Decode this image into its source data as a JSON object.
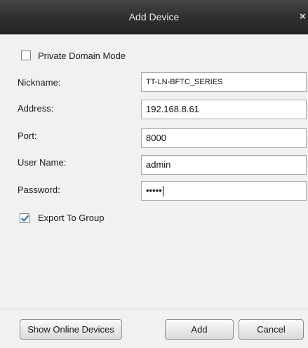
{
  "window": {
    "title": "Add Device",
    "close_glyph": "×"
  },
  "form": {
    "private_domain_label": "Private Domain Mode",
    "private_domain_checked": false,
    "fields": [
      {
        "label": "Nickname:",
        "value": "TT-LN-BFTC_SERIES"
      },
      {
        "label": "Address:",
        "value": "192.168.8.61"
      },
      {
        "label": "Port:",
        "value": "8000"
      },
      {
        "label": "User Name:",
        "value": "admin"
      },
      {
        "label": "Password:",
        "value": "•••••"
      }
    ],
    "export_group_label": "Export To Group",
    "export_group_checked": true
  },
  "buttons": {
    "show_online": "Show Online Devices",
    "add": "Add",
    "cancel": "Cancel"
  },
  "icons": {
    "close": "close-icon",
    "check": "checkmark-icon"
  },
  "colors": {
    "titlebar": "#2e2e2e",
    "checkmark": "#2a6fd6"
  }
}
